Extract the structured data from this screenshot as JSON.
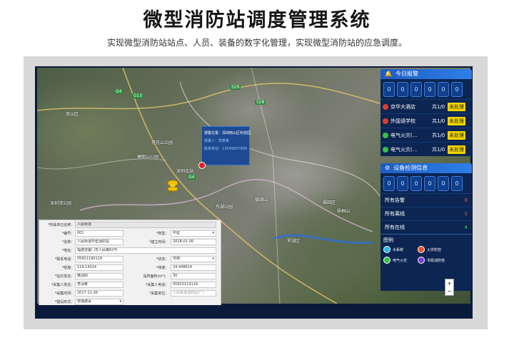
{
  "header": {
    "title": "微型消防站调度管理系统",
    "subtitle": "实现微型消防站站点、人员、装备的数字化管理，实现微型消防站的应急调度。"
  },
  "map": {
    "labels": [
      "深圳湾公园",
      "梧桐山",
      "罗湖区",
      "福田区",
      "南山区",
      "深圳北站",
      "莲花山公园",
      "东湖公园",
      "塘朗山公园",
      "银湖山"
    ],
    "highways": [
      "G4",
      "G15",
      "S29",
      "G4",
      "S28"
    ]
  },
  "popup": {
    "line1": "报警位置：深圳南山区科技园",
    "line2": "报警人：李某某",
    "line3": "联系电话：13549837899"
  },
  "today_alarm": {
    "title": "今日报警",
    "digits": [
      "0",
      "0",
      "0",
      "0",
      "0",
      "0"
    ],
    "items": [
      {
        "place": "京华大酒店",
        "count": "共1/0",
        "status": "未处理",
        "color": "#e23b2a"
      },
      {
        "place": "外国语学校",
        "count": "共1/0",
        "status": "未处理",
        "color": "#e23b2a"
      },
      {
        "place": "电气火灾(...",
        "count": "共1/0",
        "status": "未处理",
        "color": "#34c24a"
      },
      {
        "place": "电气火灾(...",
        "count": "共1/0",
        "status": "未处理",
        "color": "#34c24a"
      }
    ]
  },
  "device": {
    "title": "设备检测信息",
    "digits": [
      "0",
      "0",
      "0",
      "0",
      "0",
      "0"
    ],
    "rows": [
      {
        "label": "所有告警",
        "value": "0",
        "color": "#ff6a3d"
      },
      {
        "label": "所有离线",
        "value": "1",
        "color": "#ff6a3d"
      },
      {
        "label": "所有在线",
        "value": "4",
        "color": "#3fd26b"
      }
    ]
  },
  "legend": {
    "title": "图例",
    "items": [
      {
        "label": "水系统",
        "color": "#2bb6e8"
      },
      {
        "label": "火灾防控",
        "color": "#e8542b"
      },
      {
        "label": "电气火灾",
        "color": "#34c24a"
      },
      {
        "label": "市政消防栓",
        "color": "#7d3ad6"
      }
    ]
  },
  "form": {
    "rows": [
      {
        "l1": "*所属单位名称:",
        "v1": "人民街道",
        "l2": "",
        "v2": ""
      },
      {
        "l1": "*编号:",
        "v1": "001",
        "l2": "*类型:",
        "v2": "中型"
      },
      {
        "l1": "*名称:",
        "v1": "人民街道中型消防站",
        "l2": "*建立时间:",
        "v2": "2018-01-26"
      },
      {
        "l1": "*地址:",
        "v1": "福建省厦门市人民路62号",
        "l2": "",
        "v2": ""
      },
      {
        "l1": "*联系电话:",
        "v1": "05921190119",
        "l2": "*状态:",
        "v2": "可用"
      },
      {
        "l1": "*经度:",
        "v1": "118.14314",
        "l2": "*纬度:",
        "v2": "24.448614"
      },
      {
        "l1": "*站长姓名:",
        "v1": "黄润阳",
        "l2": "站所面积(m²):",
        "v2": "30"
      },
      {
        "l1": "*采集人姓名:",
        "v1": "李深雾",
        "l2": "*采集人电话:",
        "v2": "05920119119"
      },
      {
        "l1": "*采集时间:",
        "v1": "2017-11-26",
        "l2": "*采集单位:",
        "v2": "人民街道消防站(厂)"
      },
      {
        "l1": "*建设形式:",
        "v1": "单独建设",
        "l2": "",
        "v2": ""
      }
    ]
  }
}
